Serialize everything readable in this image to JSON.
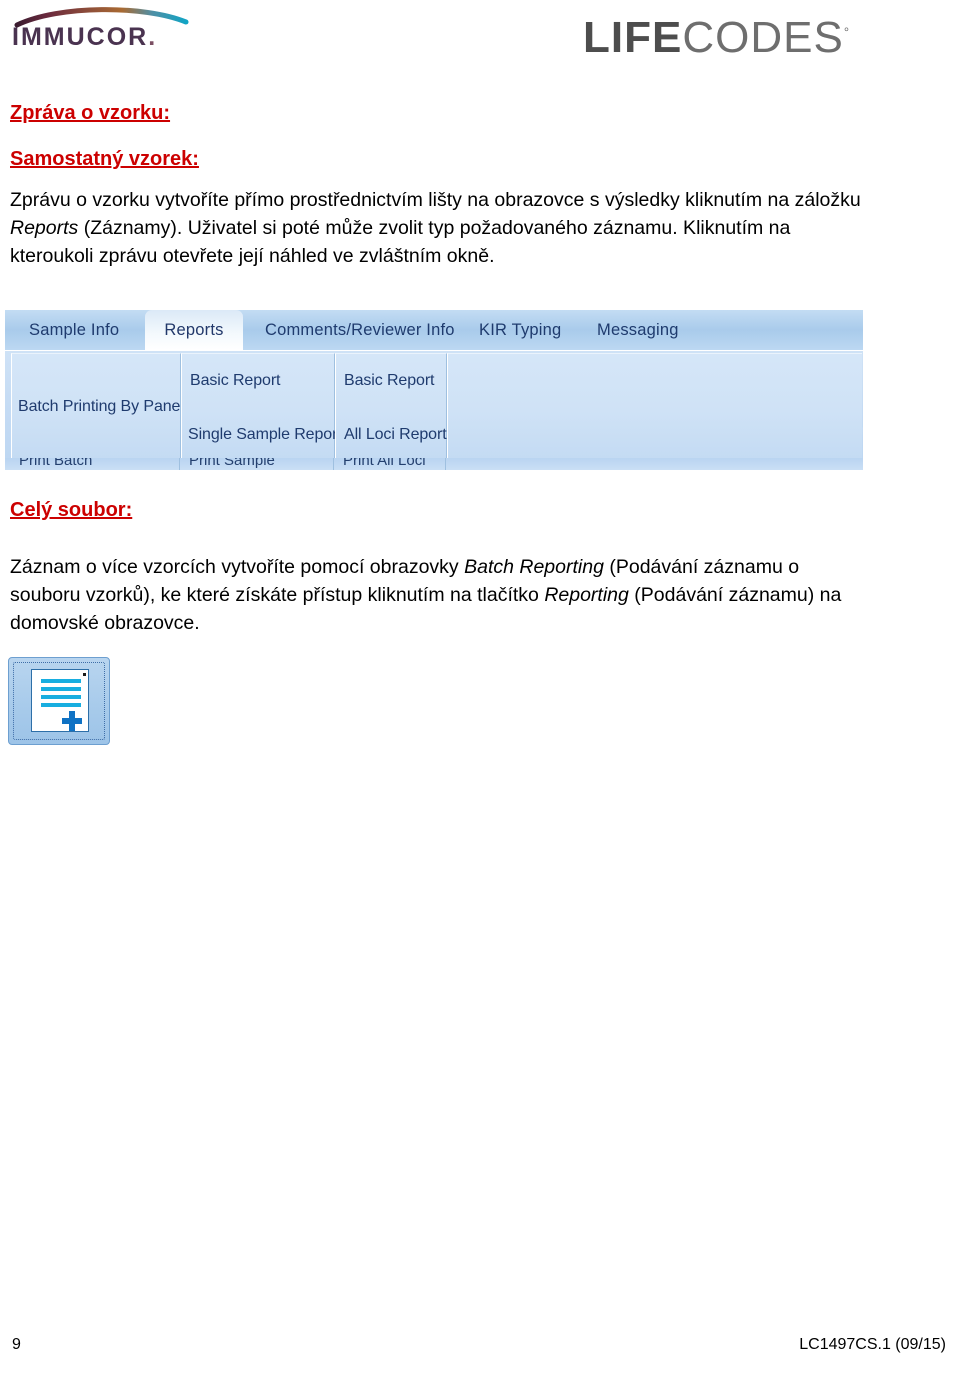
{
  "header": {
    "immucor_wordmark": "IMMUCOR",
    "immucor_period": ".",
    "lifecodes_bold": "LIFE",
    "lifecodes_thin": "CODES",
    "lifecodes_registered": "°"
  },
  "document": {
    "heading_1": "Zpráva o vzorku:",
    "heading_2": "Samostatný vzorek:",
    "paragraph_1_part1": "Zprávu o vzorku vytvoříte přímo prostřednictvím lišty na obrazovce s výsledky kliknutím na záložku ",
    "paragraph_1_italic1": "Reports",
    "paragraph_1_part2": " (Záznamy). Uživatel si poté může zvolit typ požadovaného záznamu. Kliknutím na kteroukoli zprávu otevřete její náhled ve zvláštním okně.",
    "heading_3": "Celý soubor:",
    "paragraph_2_part1": "Záznam o více vzorcích vytvoříte pomocí obrazovky ",
    "paragraph_2_italic1": "Batch Reporting",
    "paragraph_2_part2": " (Podávání záznamu o souboru vzorků), ke které získáte přístup kliknutím na tlačítko ",
    "paragraph_2_italic2": "Reporting",
    "paragraph_2_part3": " (Podávání záznamu) na domovské obrazovce."
  },
  "app_screenshot": {
    "tabs": [
      {
        "label": "Sample Info",
        "active": false
      },
      {
        "label": "Reports",
        "active": true
      },
      {
        "label": "Comments/Reviewer Info",
        "active": false
      },
      {
        "label": "KIR Typing",
        "active": false
      },
      {
        "label": "Messaging",
        "active": false
      }
    ],
    "ribbon_groups": [
      {
        "items": [
          "Batch Printing By Panel"
        ]
      },
      {
        "items": [
          "Basic Report",
          "Single Sample Report"
        ]
      },
      {
        "items": [
          "Basic Report",
          "All Loci Report"
        ]
      },
      {
        "items": []
      }
    ],
    "cut_off_row": [
      "Print Batch",
      "Print Sample",
      "Print All Loci"
    ]
  },
  "reporting_button": {
    "name": "Reporting"
  },
  "footer": {
    "page_number": "9",
    "document_code": "LC1497CS.1 (09/15)"
  },
  "colors": {
    "heading_red": "#cc0000",
    "ribbon_blue": "#c6dcf4",
    "tab_text": "#1f3b6e",
    "icon_cyan": "#18aee0",
    "icon_blue": "#0f72c4"
  }
}
